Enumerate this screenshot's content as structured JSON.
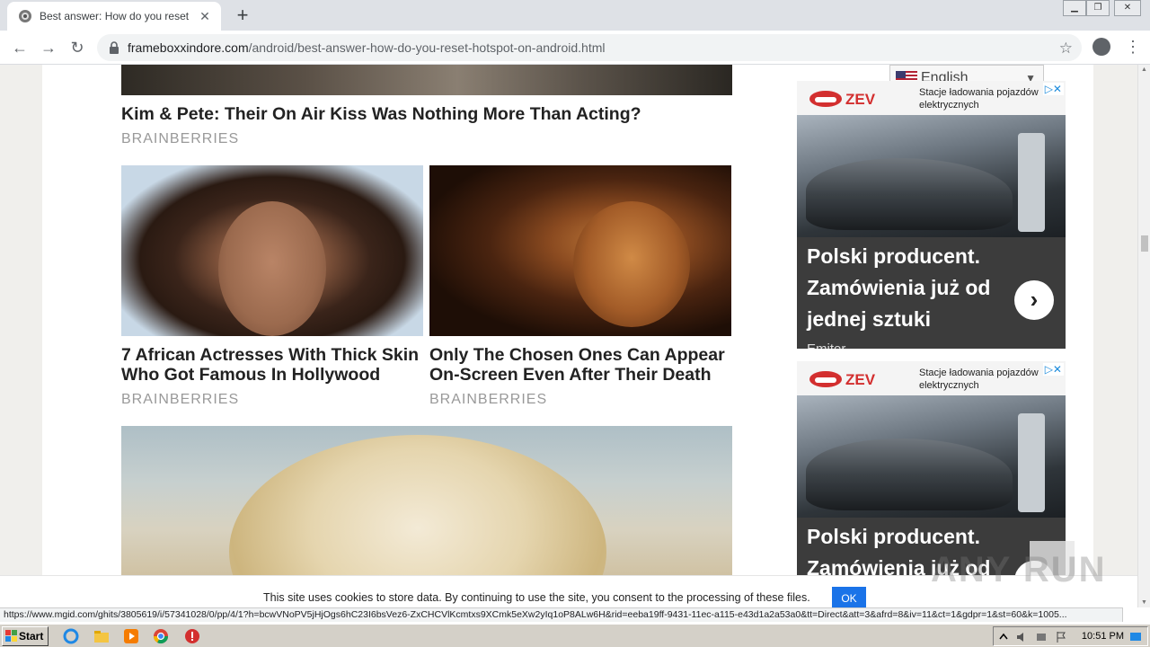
{
  "browser": {
    "tab_title": "Best answer: How do you reset hots",
    "tab_close": "✕",
    "new_tab": "+",
    "url_host": "frameboxxindore.com",
    "url_path": "/android/best-answer-how-do-you-reset-hotspot-on-android.html",
    "window_buttons": [
      "▁",
      "❐",
      "✕"
    ]
  },
  "articles": [
    {
      "title": "Kim & Pete: Their On Air Kiss Was Nothing More Than Acting?",
      "source": "BRAINBERRIES"
    },
    {
      "title": "7 African Actresses With Thick Skin Who Got Famous In Hollywood",
      "source": "BRAINBERRIES"
    },
    {
      "title": "Only The Chosen Ones Can Appear On-Screen Even After Their Death",
      "source": "BRAINBERRIES"
    }
  ],
  "language": {
    "label": "English"
  },
  "ads": [
    {
      "logo": "ZEV",
      "slogan": "Stacje ładowania pojazdów elektrycznych",
      "text": "Polski producent. Zamówienia już od jednej sztuki",
      "brand": "Emiter",
      "arrow": "›",
      "adchoices": "▷✕"
    },
    {
      "logo": "ZEV",
      "slogan": "Stacje ładowania pojazdów elektrycznych",
      "text": "Polski producent. Zamówienia już od",
      "brand": "",
      "arrow": "›",
      "adchoices": "▷✕"
    }
  ],
  "cookie": {
    "text": "This site uses cookies to store data. By continuing to use the site, you consent to the processing of these files.",
    "ok": "OK"
  },
  "watermark": "ANY RUN",
  "status_url": "https://www.mgid.com/ghits/3805619/i/57341028/0/pp/4/1?h=bcwVNoPV5jHjOgs6hC23I6bsVez6-ZxCHCVlKcmtxs9XCmk5eXw2yIq1oP8ALw6H&rid=eeba19ff-9431-11ec-a115-e43d1a2a53a0&tt=Direct&att=3&afrd=8&iv=11&ct=1&gdpr=1&st=60&k=1005...",
  "taskbar": {
    "start": "Start",
    "clock": "10:51 PM"
  }
}
